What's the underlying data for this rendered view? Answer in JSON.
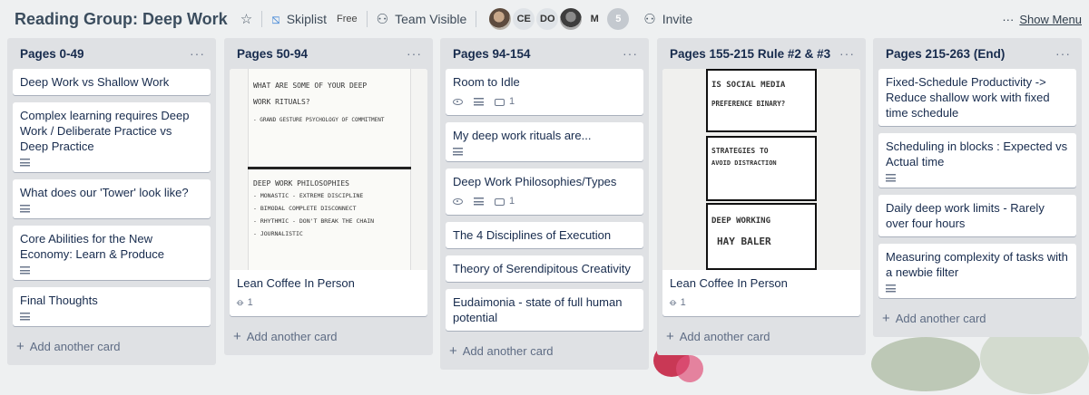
{
  "header": {
    "board_title": "Reading Group: Deep Work",
    "star_icon": "star-icon",
    "team_name": "Skiplist",
    "team_plan": "Free",
    "visibility": "Team Visible",
    "avatars": [
      "CE",
      "DO",
      "M"
    ],
    "member_extra_count": "5",
    "invite_label": "Invite",
    "menu_dots": "···",
    "show_menu_label": "Show Menu"
  },
  "lists": [
    {
      "title": "Pages 0-49",
      "cards": [
        {
          "title": "Deep Work vs Shallow Work"
        },
        {
          "title": "Complex learning requires Deep Work / Deliberate Practice vs Deep Practice"
        },
        {
          "title": "What does our 'Tower' look like?"
        },
        {
          "title": "Core Abilities for the New Economy: Learn & Produce"
        },
        {
          "title": "Final Thoughts"
        }
      ],
      "add_label": "Add another card"
    },
    {
      "title": "Pages 50-94",
      "cards": [
        {
          "title": "Lean Coffee In Person",
          "attachments": "1"
        }
      ],
      "add_label": "Add another card"
    },
    {
      "title": "Pages 94-154",
      "cards": [
        {
          "title": "Room to Idle",
          "comments": "1"
        },
        {
          "title": "My deep work rituals are..."
        },
        {
          "title": "Deep Work Philosophies/Types",
          "comments": "1"
        },
        {
          "title": "The 4 Disciplines of Execution"
        },
        {
          "title": "Theory of Serendipitous Creativity"
        },
        {
          "title": "Eudaimonia - state of full human potential"
        }
      ],
      "add_label": "Add another card"
    },
    {
      "title": "Pages 155-215 Rule #2 & #3",
      "cards": [
        {
          "title": "Lean Coffee In Person",
          "attachments": "1"
        }
      ],
      "add_label": "Add another card"
    },
    {
      "title": "Pages 215-263 (End)",
      "cards": [
        {
          "title": "Fixed-Schedule Productivity -> Reduce shallow work with fixed time schedule"
        },
        {
          "title": "Scheduling in blocks : Expected vs Actual time"
        },
        {
          "title": "Daily deep work limits - Rarely over four hours"
        },
        {
          "title": "Measuring complexity of tasks with a newbie filter"
        }
      ],
      "add_label": "Add another card"
    }
  ],
  "list_menu_dots": "···",
  "plus": "+",
  "sketch_text": {
    "l1_line1": "WHAT ARE SOME OF YOUR DEEP",
    "l1_line2": "WORK RITUALS?",
    "l1_line3": "- GRAND GESTURE   PSYCHOLOGY OF COMMITMENT",
    "l1_line4": "DEEP WORK PHILOSOPHIES",
    "l1_line5": "- MONASTIC    - EXTREME DISCIPLINE",
    "l1_line6": "- BIMODAL     COMPLETE DISCONNECT",
    "l1_line7": "- RHYTHMIC    - DON'T BREAK THE CHAIN",
    "l1_line8": "- JOURNALISTIC",
    "l3_line1": "IS SOCIAL MEDIA",
    "l3_line2": "PREFERENCE BINARY?",
    "l3_line3": "STRATEGIES TO",
    "l3_line4": "AVOID DISTRACTION",
    "l3_line5": "DEEP WORKING",
    "l3_line6": "HAY BALER"
  },
  "colors": {
    "list_bg": "#dfe1e4",
    "accent": "#172b4d"
  }
}
